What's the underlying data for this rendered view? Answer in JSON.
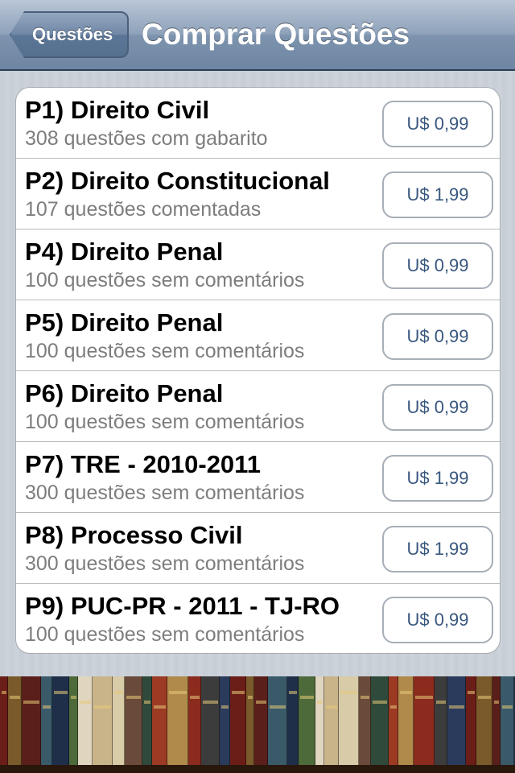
{
  "navbar": {
    "back_label": "Questões",
    "title": "Comprar Questões"
  },
  "items": [
    {
      "title": "P1) Direito Civil",
      "subtitle": "308 questões com gabarito",
      "price": "U$ 0,99"
    },
    {
      "title": "P2) Direito Constitucional",
      "subtitle": "107 questões comentadas",
      "price": "U$ 1,99"
    },
    {
      "title": "P4) Direito Penal",
      "subtitle": "100 questões sem comentários",
      "price": "U$ 0,99"
    },
    {
      "title": "P5) Direito Penal",
      "subtitle": "100 questões sem comentários",
      "price": "U$ 0,99"
    },
    {
      "title": "P6) Direito Penal",
      "subtitle": "100 questões sem comentários",
      "price": "U$ 0,99"
    },
    {
      "title": "P7) TRE - 2010-2011",
      "subtitle": "300 questões sem comentários",
      "price": "U$ 1,99"
    },
    {
      "title": "P8) Processo Civil",
      "subtitle": "300 questões sem comentários",
      "price": "U$ 1,99"
    },
    {
      "title": "P9) PUC-PR - 2011 - TJ-RO",
      "subtitle": "100 questões sem comentários",
      "price": "U$ 0,99"
    }
  ],
  "colors": {
    "navbar": "#7d93ae",
    "price_text": "#38577e",
    "subtitle_text": "#7d7d7d",
    "page_background": "#c5ccd4"
  },
  "decor": {
    "bookshelf_image": "bookshelf-image"
  }
}
